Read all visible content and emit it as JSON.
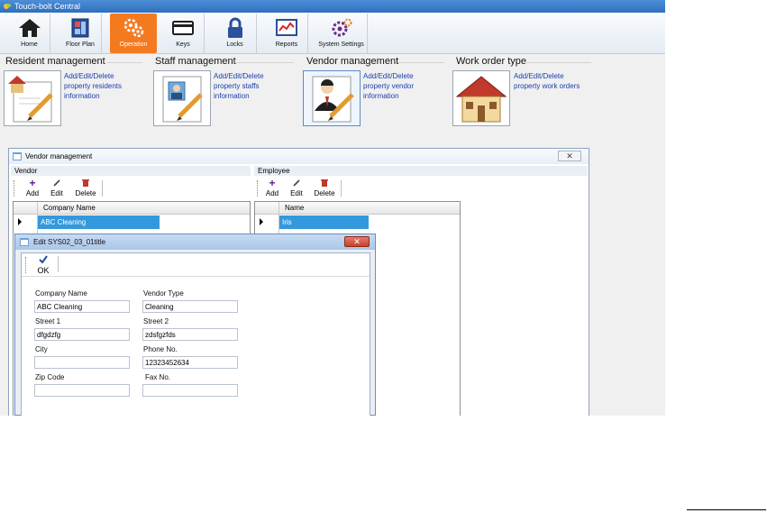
{
  "app": {
    "title": "Touch-bolt Central"
  },
  "ribbon": {
    "items": [
      {
        "label": "Home",
        "icon": "home-icon"
      },
      {
        "label": "Floor Plan",
        "icon": "floor-plan-icon"
      },
      {
        "label": "Operation",
        "icon": "gears-icon",
        "active": true
      },
      {
        "label": "Keys",
        "icon": "card-icon"
      },
      {
        "label": "Locks",
        "icon": "lock-icon"
      },
      {
        "label": "Reports",
        "icon": "chart-icon"
      },
      {
        "label": "System Settings",
        "icon": "settings-icon"
      }
    ],
    "active_color": "#f47a20"
  },
  "sections": [
    {
      "title": "Resident management",
      "desc": [
        "Add/Edit/Delete",
        "property residents",
        "information"
      ]
    },
    {
      "title": "Staff management",
      "desc": [
        "Add/Edit/Delete",
        "property staffs",
        "information"
      ]
    },
    {
      "title": "Vendor management",
      "desc": [
        "Add/Edit/Delete",
        "property vendor",
        "information"
      ]
    },
    {
      "title": "Work order type",
      "desc": [
        "Add/Edit/Delete",
        "property work orders"
      ]
    }
  ],
  "vendor_window": {
    "title": "Vendor management",
    "vendor_group": "Vendor",
    "employee_group": "Employee",
    "toolbar": {
      "add": "Add",
      "edit": "Edit",
      "delete": "Delete"
    },
    "vendor_grid": {
      "column": "Company Name",
      "rows": [
        "ABC Cleaning"
      ]
    },
    "employee_grid": {
      "column": "Name",
      "rows": [
        "Iris"
      ]
    }
  },
  "edit_dialog": {
    "title": "Edit SYS02_03_01title",
    "ok_label": "OK",
    "fields": {
      "company_name": {
        "label": "Company Name",
        "value": "ABC Cleaning"
      },
      "vendor_type": {
        "label": "Vendor Type",
        "value": "Cleaning"
      },
      "street1": {
        "label": "Street 1",
        "value": "dfgdzfg"
      },
      "street2": {
        "label": "Street 2",
        "value": "zdsfgzfds"
      },
      "city": {
        "label": "City",
        "value": ""
      },
      "phone": {
        "label": "Phone No.",
        "value": "12323452634"
      },
      "zip": {
        "label": "Zip Code",
        "value": ""
      },
      "fax": {
        "label": "Fax No.",
        "value": ""
      }
    }
  },
  "colors": {
    "selection": "#3399dd",
    "link": "#1a3fb0"
  }
}
